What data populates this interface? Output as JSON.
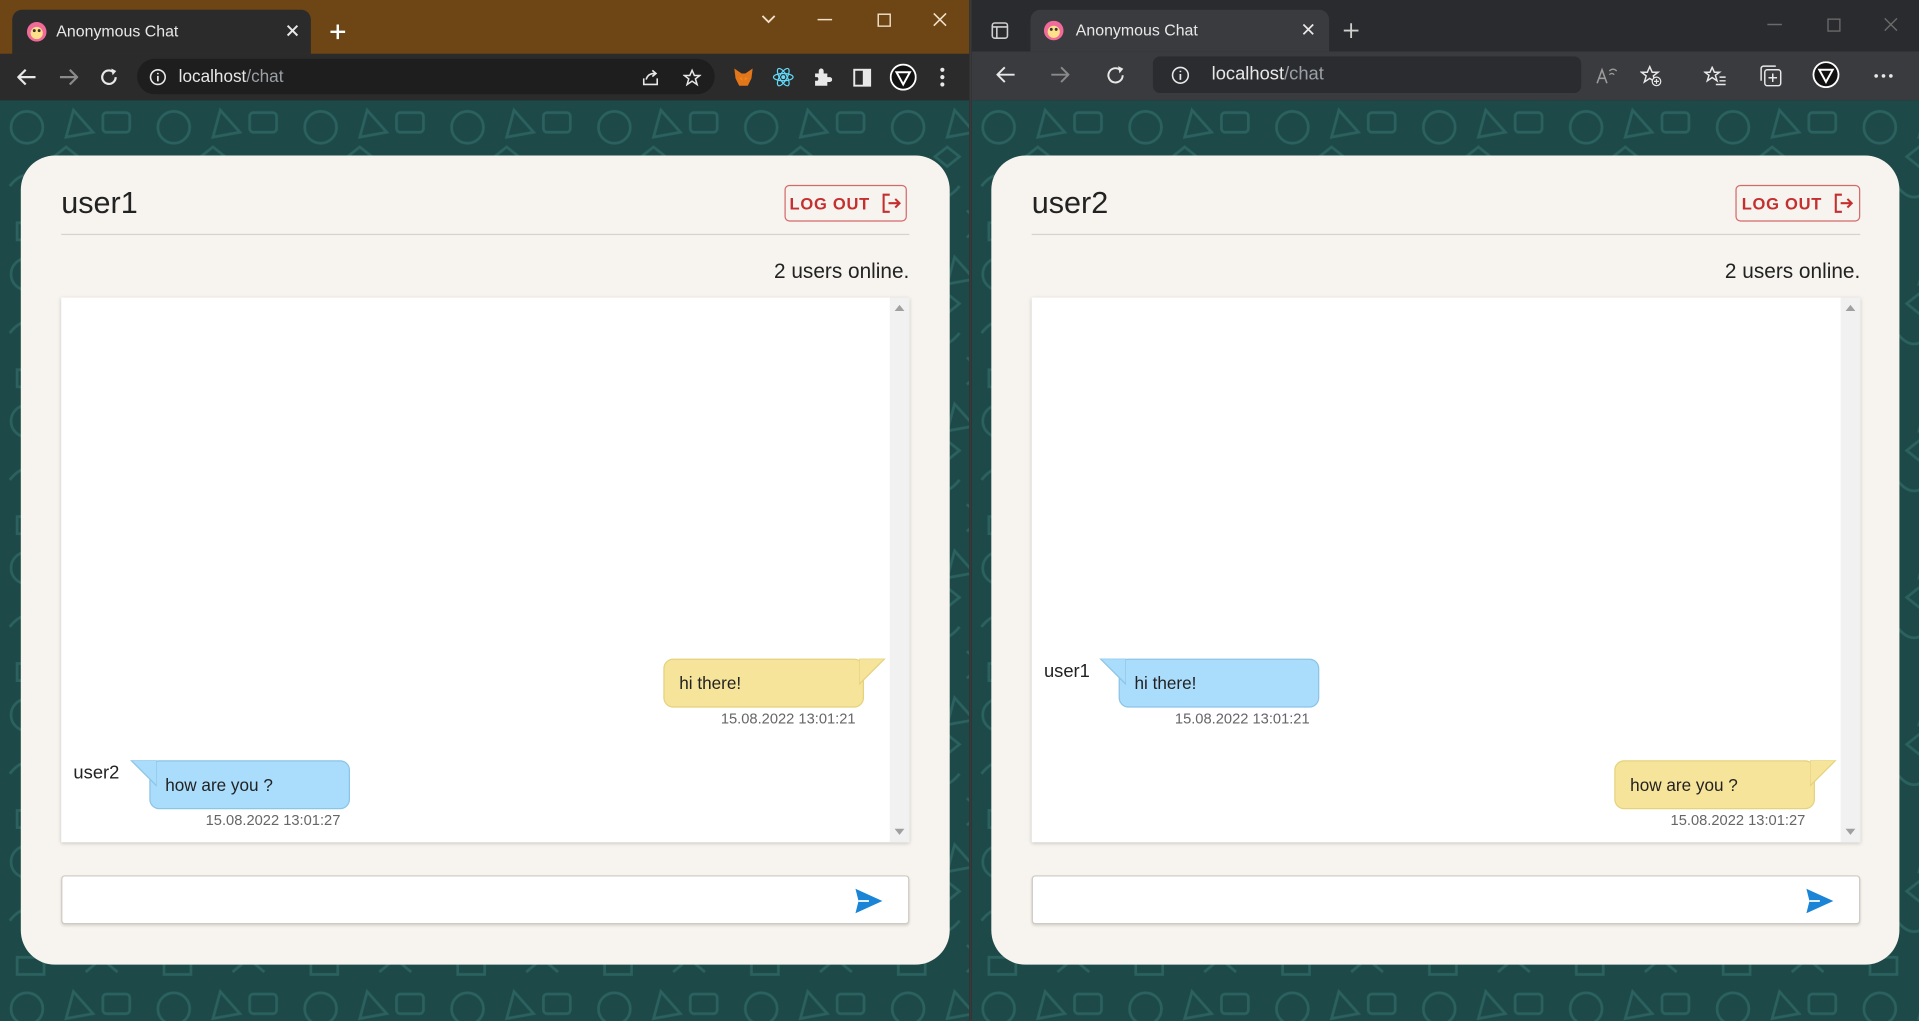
{
  "windows": [
    {
      "browser": "chrome",
      "tab_title": "Anonymous Chat",
      "url_host": "localhost",
      "url_path": "/chat",
      "chat": {
        "username": "user1",
        "logout_label": "LOG OUT",
        "online_text": "2 users online.",
        "messages": [
          {
            "text": "hi there!",
            "timestamp": "15.08.2022 13:01:21",
            "own": true,
            "sender": ""
          },
          {
            "text": "how are you ?",
            "timestamp": "15.08.2022 13:01:27",
            "own": false,
            "sender": "user2"
          }
        ],
        "input_value": ""
      }
    },
    {
      "browser": "edge",
      "tab_title": "Anonymous Chat",
      "url_host": "localhost",
      "url_path": "/chat",
      "chat": {
        "username": "user2",
        "logout_label": "LOG OUT",
        "online_text": "2 users online.",
        "messages": [
          {
            "text": "hi there!",
            "timestamp": "15.08.2022 13:01:21",
            "own": false,
            "sender": "user1"
          },
          {
            "text": "how are you ?",
            "timestamp": "15.08.2022 13:01:27",
            "own": true,
            "sender": ""
          }
        ],
        "input_value": ""
      }
    }
  ],
  "colors": {
    "chrome_tabbar": "#6e4514",
    "page_background": "#1d4a48",
    "card": "#f7f3ee",
    "own_bubble": "#f6e49a",
    "other_bubble": "#aadcfb",
    "logout": "#c43030",
    "send_icon": "#1a84d6"
  }
}
